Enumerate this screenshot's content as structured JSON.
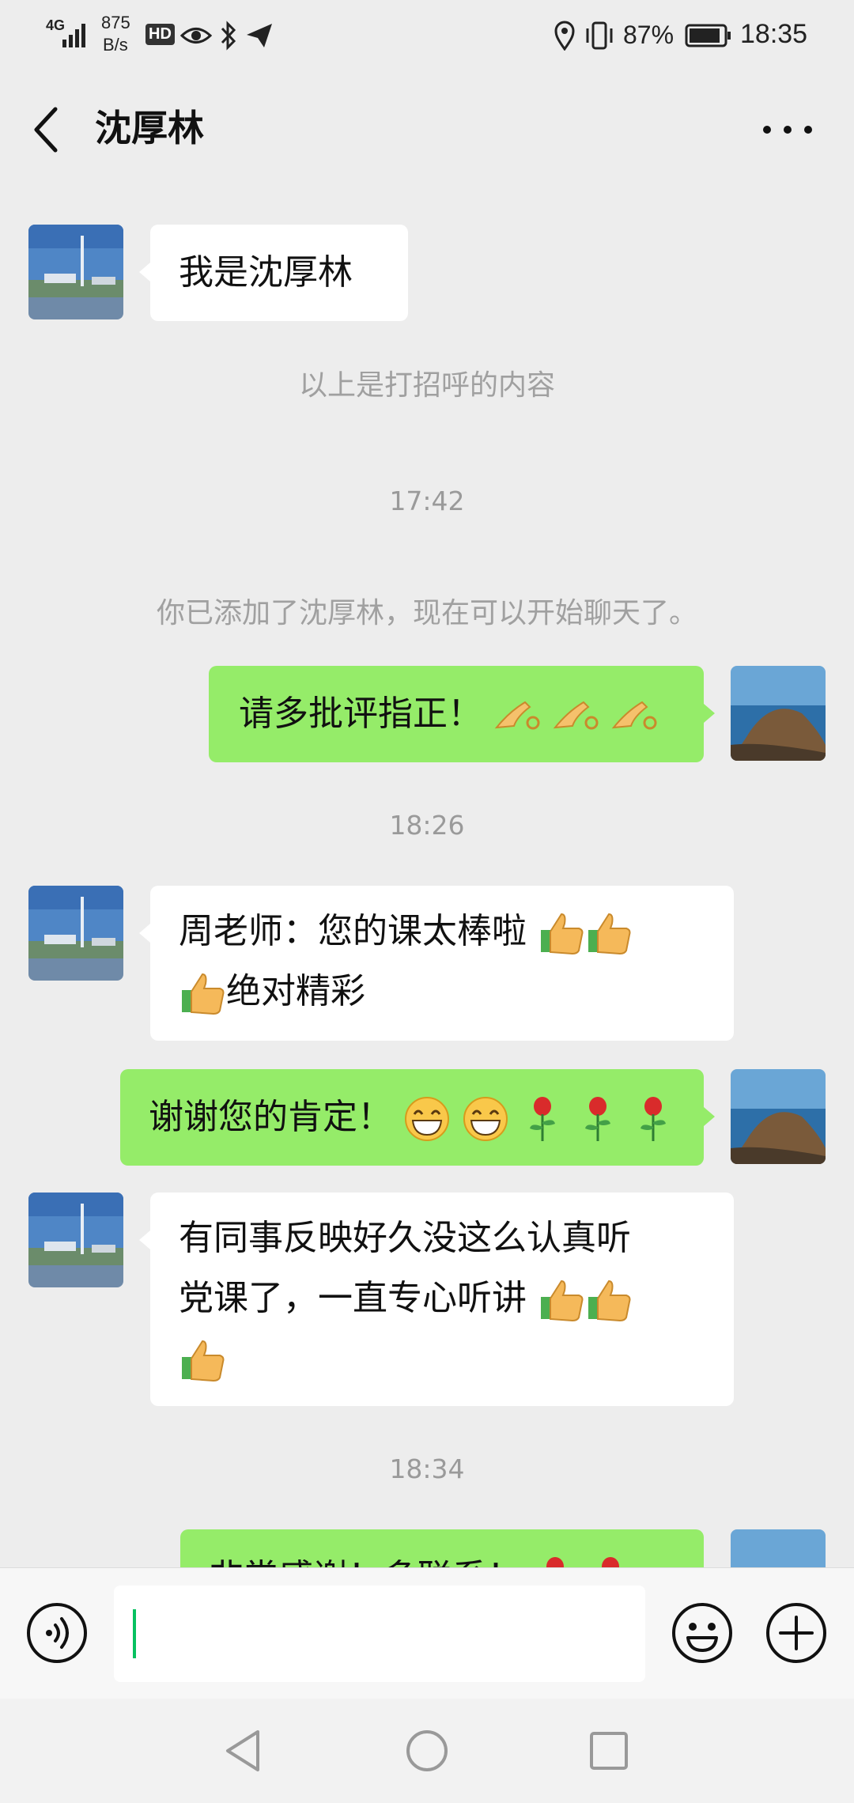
{
  "status_bar": {
    "network": "4G",
    "speed_value": "875",
    "speed_unit": "B/s",
    "hd_badge": "HD",
    "battery": "87%",
    "time": "18:35"
  },
  "header": {
    "title": "沈厚林"
  },
  "messages": {
    "m1": "我是沈厚林",
    "greeting_note": "以上是打招呼的内容",
    "t1": "17:42",
    "added_note": "你已添加了沈厚林，现在可以开始聊天了。",
    "m2": "请多批评指正！",
    "t2": "18:26",
    "m3_line1": "周老师：您的课太棒啦",
    "m3_line2": "绝对精彩",
    "m4": "谢谢您的肯定！",
    "m5_line1": "有同事反映好久没这么认真听",
    "m5_line2": "党课了，一直专心听讲",
    "t3": "18:34",
    "m6_partial": "非常感谢！多联系！"
  },
  "icons": {
    "back": "back-arrow-icon",
    "more": "more-dots-icon",
    "voice": "voice-icon",
    "emoji": "emoji-icon",
    "plus": "plus-icon",
    "ok_hand": "ok-hand-emoji",
    "thumbs_up": "thumbs-up-emoji",
    "grin": "grin-emoji",
    "rose": "rose-emoji"
  },
  "colors": {
    "sent_bubble": "#95ec69",
    "received_bubble": "#ffffff",
    "background": "#ededed",
    "caret": "#07c160"
  }
}
